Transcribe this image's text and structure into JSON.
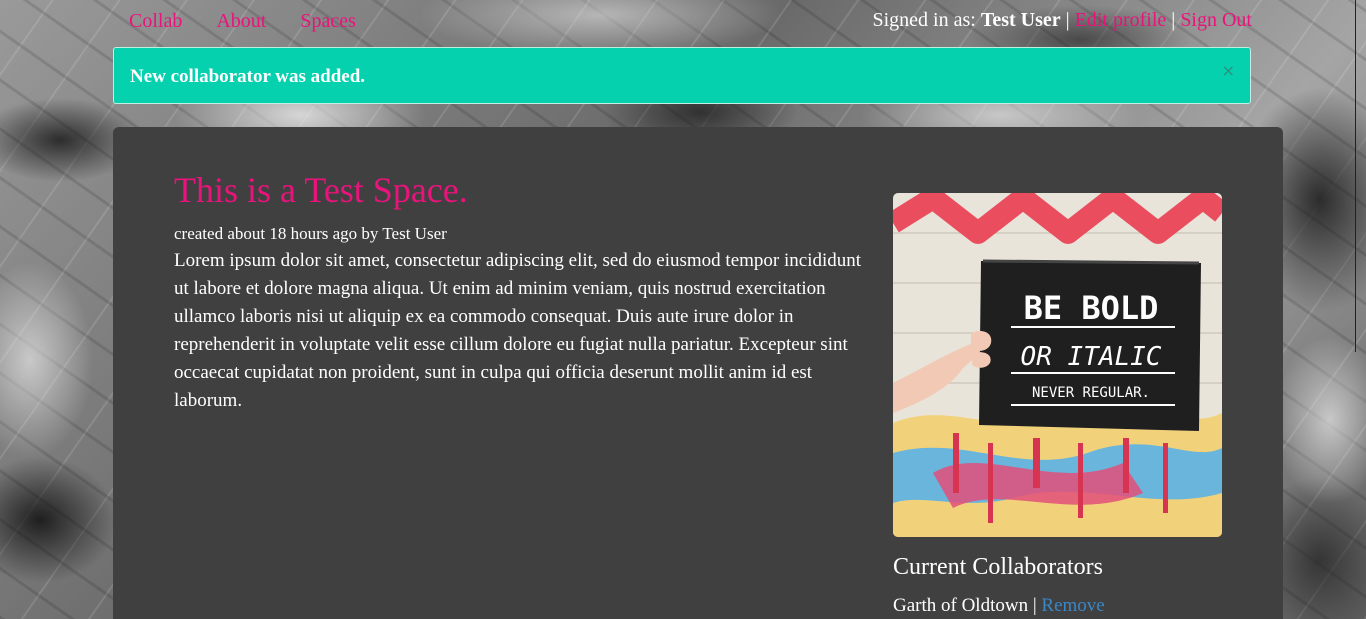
{
  "nav": {
    "links": [
      "Collab",
      "About",
      "Spaces"
    ],
    "signed_in_label": "Signed in as:",
    "user_name": "Test User",
    "separator": "|",
    "edit_profile": "Edit profile",
    "sign_out": "Sign Out"
  },
  "alert": {
    "message": "New collaborator was added.",
    "close": "×"
  },
  "space": {
    "title": "This is a Test Space.",
    "meta": "created about 18 hours ago by Test User",
    "description": "Lorem ipsum dolor sit amet, consectetur adipiscing elit, sed do eiusmod tempor incididunt ut labore et dolore magna aliqua. Ut enim ad minim veniam, quis nostrud exercitation ullamco laboris nisi ut aliquip ex ea commodo consequat. Duis aute irure dolor in reprehenderit in voluptate velit esse cillum dolore eu fugiat nulla pariatur. Excepteur sint occaecat cupidatat non proident, sunt in culpa qui officia deserunt mollit anim id est laborum.",
    "image_lines": [
      "BE BOLD",
      "OR ITALIC",
      "NEVER REGULAR."
    ]
  },
  "collaborators": {
    "heading": "Current Collaborators",
    "items": [
      {
        "name": "Garth of Oldtown",
        "action": "Remove"
      }
    ]
  },
  "colors": {
    "accent": "#e8137b",
    "alert_bg": "#05d1ae",
    "panel_bg": "#404040",
    "link_blue": "#3a87c8"
  }
}
